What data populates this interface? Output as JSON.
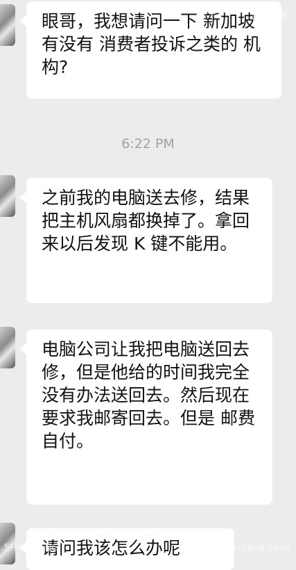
{
  "messages": [
    {
      "text": "眼哥，我想请问一下 新加坡有没有 消费者投诉之类的 机构?"
    },
    {
      "text": "之前我的电脑送去修，结果把主机风扇都换掉了。拿回来以后发现 K 键不能用。"
    },
    {
      "text": "电脑公司让我把电脑送回去修，但是他给的时间我完全没有办法送回去。然后现在要求我邮寄回去。但是 邮费自付。"
    },
    {
      "text": "请问我该怎么办呢"
    }
  ],
  "timestamp": "6:22 PM",
  "watermarks": {
    "top_right": "新加坡眼",
    "bottom_left": "SHINCHENG",
    "bottom_right": "shincheng.news"
  }
}
